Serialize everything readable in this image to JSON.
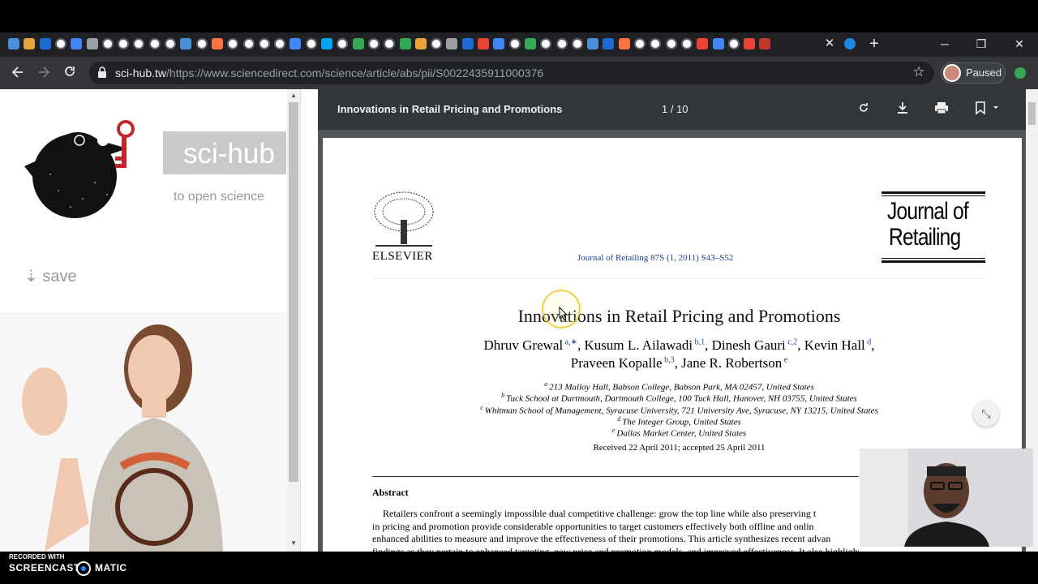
{
  "browser": {
    "active_tab_close": "✕",
    "new_tab": "+",
    "window_controls": {
      "minimize": "─",
      "maximize": "❐",
      "close": "✕"
    },
    "url_host": "sci-hub.tw",
    "url_path": "/https://www.sciencedirect.com/science/article/abs/pii/S0022435911000376",
    "profile_label": "Paused",
    "icons": [
      "back-icon",
      "forward-icon",
      "reload-icon",
      "lock-icon",
      "star-icon",
      "extension-icon"
    ]
  },
  "scihub": {
    "brand": "sci-hub",
    "tagline": "to open science",
    "save": "⇣ save"
  },
  "pdf_viewer": {
    "title": "Innovations in Retail Pricing and Promotions",
    "page_indicator": "1 / 10",
    "icons": [
      "rotate-icon",
      "download-icon",
      "print-icon",
      "bookmark-icon"
    ]
  },
  "paper": {
    "publisher": "ELSEVIER",
    "citation": "Journal of Retailing 87S (1, 2011) S43–S52",
    "journal_logo_line1": "Journal of",
    "journal_logo_line2": "Retailing",
    "title": "Innovations in Retail Pricing and Promotions",
    "authors_line1": [
      {
        "name": "Dhruv Grewal",
        "sup": "a,∗"
      },
      {
        "name": "Kusum L. Ailawadi",
        "sup": "b,1"
      },
      {
        "name": "Dinesh Gauri",
        "sup": "c,2"
      },
      {
        "name": "Kevin Hall",
        "sup": "d"
      }
    ],
    "authors_line2": [
      {
        "name": "Praveen Kopalle",
        "sup": "b,3"
      },
      {
        "name": "Jane R. Robertson",
        "sup": "e"
      }
    ],
    "affiliations": [
      {
        "sup": "a",
        "text": "213 Malloy Hall, Babson College, Babson Park, MA 02457, United States"
      },
      {
        "sup": "b",
        "text": "Tuck School at Dartmouth, Dartmouth College, 100 Tuck Hall, Hanover, NH 03755, United States"
      },
      {
        "sup": "c",
        "text": "Whitman School of Management, Syracuse University, 721 University Ave, Syracuse, NY 13215, United States"
      },
      {
        "sup": "d",
        "text": "The Integer Group, United States"
      },
      {
        "sup": "e",
        "text": "Dallas Market Center, United States"
      }
    ],
    "received": "Received 22 April 2011; accepted 25 April 2011",
    "abstract_heading": "Abstract",
    "abstract_lines": [
      "Retailers confront a seemingly impossible dual competitive challenge: grow the top line while also preserving t",
      "in pricing and promotion provide considerable opportunities to target customers effectively both offline and onlin",
      "enhanced abilities to measure and improve the effectiveness of their promotions. This article synthesizes recent advan",
      "findings as they pertain to enhanced targeting, new price and promotion models, and improved effectiveness. It also highlights the role of new"
    ]
  },
  "recorder": {
    "recorded_with": "RECORDED WITH",
    "brand_left": "SCREENCAST",
    "brand_right": "MATIC"
  }
}
